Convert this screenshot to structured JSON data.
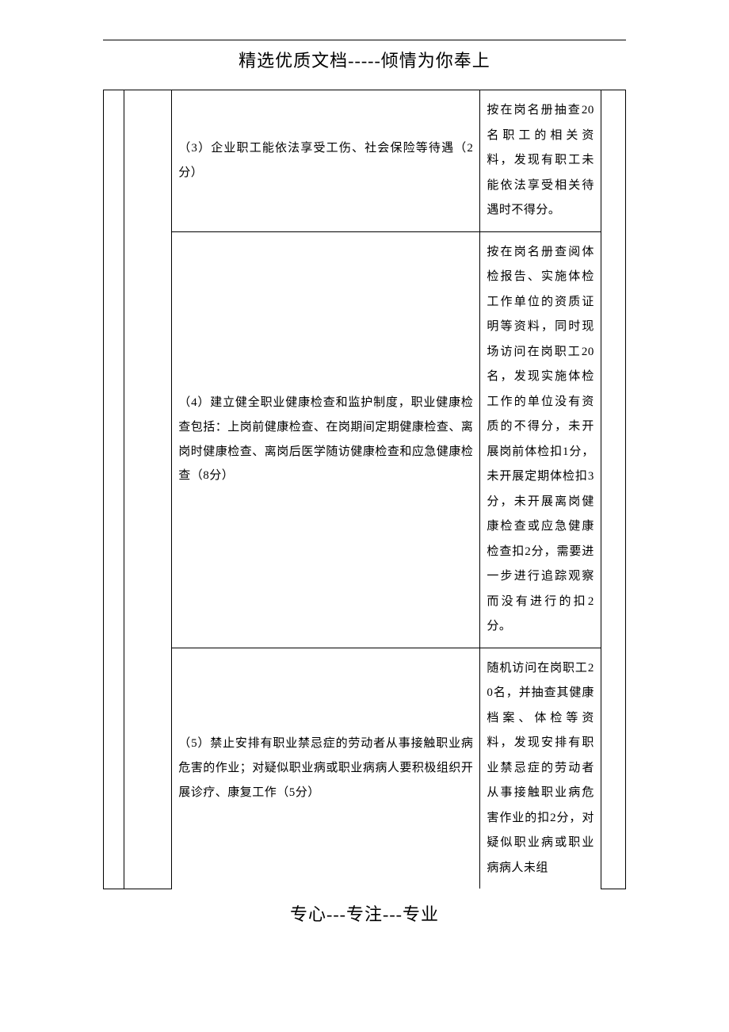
{
  "header": "精选优质文档-----倾情为你奉上",
  "footer": "专心---专注---专业",
  "rows": [
    {
      "criteria": "（3）企业职工能依法享受工伤、社会保险等待遇（2分）",
      "method": "按在岗名册抽查20名职工的相关资料，发现有职工未能依法享受相关待遇时不得分。"
    },
    {
      "criteria": "（4）建立健全职业健康检查和监护制度，职业健康检查包括：上岗前健康检查、在岗期间定期健康检查、离岗时健康检查、离岗后医学随访健康检查和应急健康检查（8分）",
      "method": "按在岗名册查阅体检报告、实施体检工作单位的资质证明等资料，同时现场访问在岗职工20名，发现实施体检工作的单位没有资质的不得分，未开展岗前体检扣1分，未开展定期体检扣3分，未开展离岗健康检查或应急健康检查扣2分，需要进一步进行追踪观察而没有进行的扣2分。"
    },
    {
      "criteria": "（5）禁止安排有职业禁忌症的劳动者从事接触职业病危害的作业；对疑似职业病或职业病病人要积极组织开展诊疗、康复工作（5分）",
      "method": "随机访问在岗职工20名，并抽查其健康档案、体检等资料，发现安排有职业禁忌症的劳动者从事接触职业病危害作业的扣2分，对疑似职业病或职业病病人未组"
    }
  ]
}
